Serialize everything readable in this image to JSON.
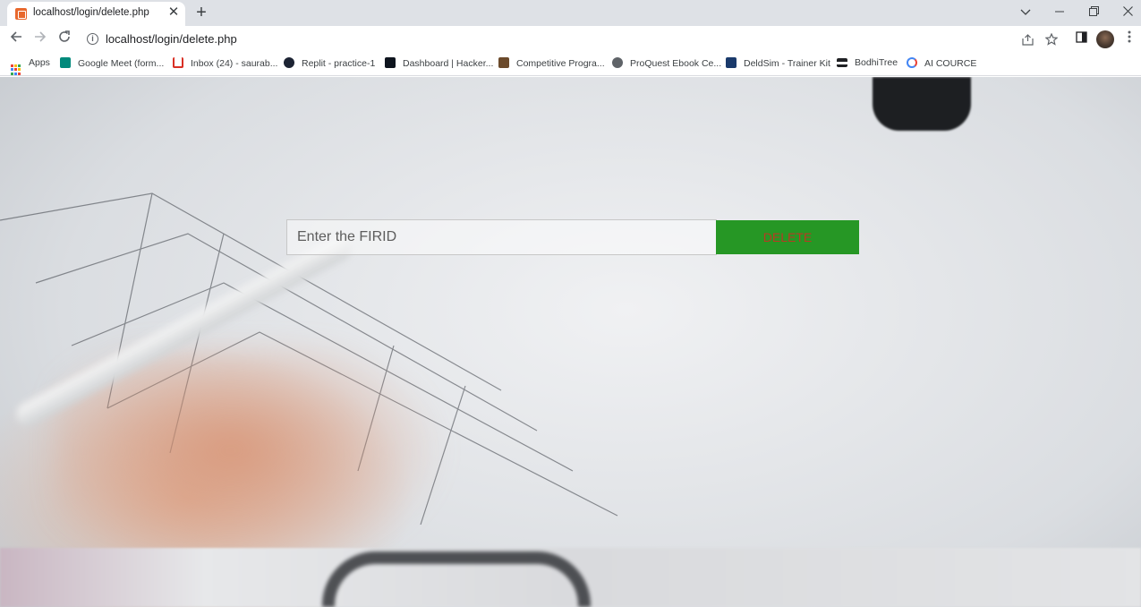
{
  "browser": {
    "tab_title": "localhost/login/delete.php",
    "tab_close": "✕",
    "new_tab": "+",
    "url": "localhost/login/delete.php",
    "bookmarks": [
      {
        "label": "Apps",
        "icon": "apps-grid-icon"
      },
      {
        "label": "Google Meet (form...",
        "icon": "google-meet-icon",
        "color": "#00897b"
      },
      {
        "label": "Inbox (24) - saurab...",
        "icon": "gmail-icon",
        "color": "#d93025"
      },
      {
        "label": "Replit - practice-1",
        "icon": "replit-icon",
        "color": "#1c2333"
      },
      {
        "label": "Dashboard | Hacker...",
        "icon": "hackerrank-icon",
        "color": "#0e141e"
      },
      {
        "label": "Competitive Progra...",
        "icon": "codechef-icon",
        "color": "#6b4a2b"
      },
      {
        "label": "ProQuest Ebook Ce...",
        "icon": "globe-icon",
        "color": "#5f6368"
      },
      {
        "label": "DeldSim - Trainer Kit",
        "icon": "deldsim-icon",
        "color": "#1a3a6b"
      },
      {
        "label": "BodhiTree",
        "icon": "graduation-cap-icon",
        "color": "#202124"
      },
      {
        "label": "AI COURCE",
        "icon": "google-icon",
        "color": "#4285f4"
      }
    ]
  },
  "page": {
    "firid_placeholder": "Enter the FIRID",
    "delete_label": "DELETE"
  },
  "colors": {
    "delete_button_bg": "#269725",
    "delete_button_text": "#b83a23"
  }
}
